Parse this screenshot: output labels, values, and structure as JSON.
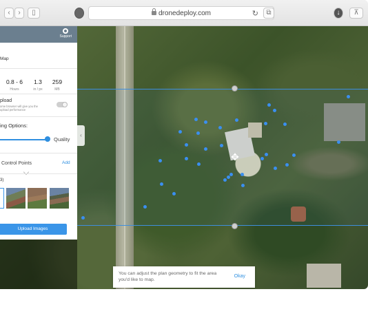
{
  "browser": {
    "url": "dronedeploy.com",
    "reload_icon": "reload-icon",
    "lock_icon": "lock-icon"
  },
  "panel": {
    "support_label": "Support",
    "support_icon": "lifebuoy-icon",
    "map_label": "Map",
    "stats": [
      {
        "value": "0.8 - 6",
        "label": "Hours"
      },
      {
        "value": "1.3",
        "label": "in / px"
      },
      {
        "value": "259",
        "label": "MB"
      }
    ],
    "upload_title": "pload",
    "upload_desc": "ome browser will give you the\nupload performance",
    "upload_toggle_on": false,
    "processing_title": "ing Options:",
    "quality_label": "Quality",
    "quality_level": 1.0,
    "gcp_title": "Control Points",
    "gcp_add": "Add",
    "image_count": "3)",
    "upload_button": "Upload Images"
  },
  "toast": {
    "message": "You can adjust the plan geometry to fit the area you'd like to map.",
    "ok": "Okay"
  },
  "colors": {
    "accent": "#3a95e8",
    "header": "#6b7f8f",
    "plan_line": "#3d8fe0"
  }
}
